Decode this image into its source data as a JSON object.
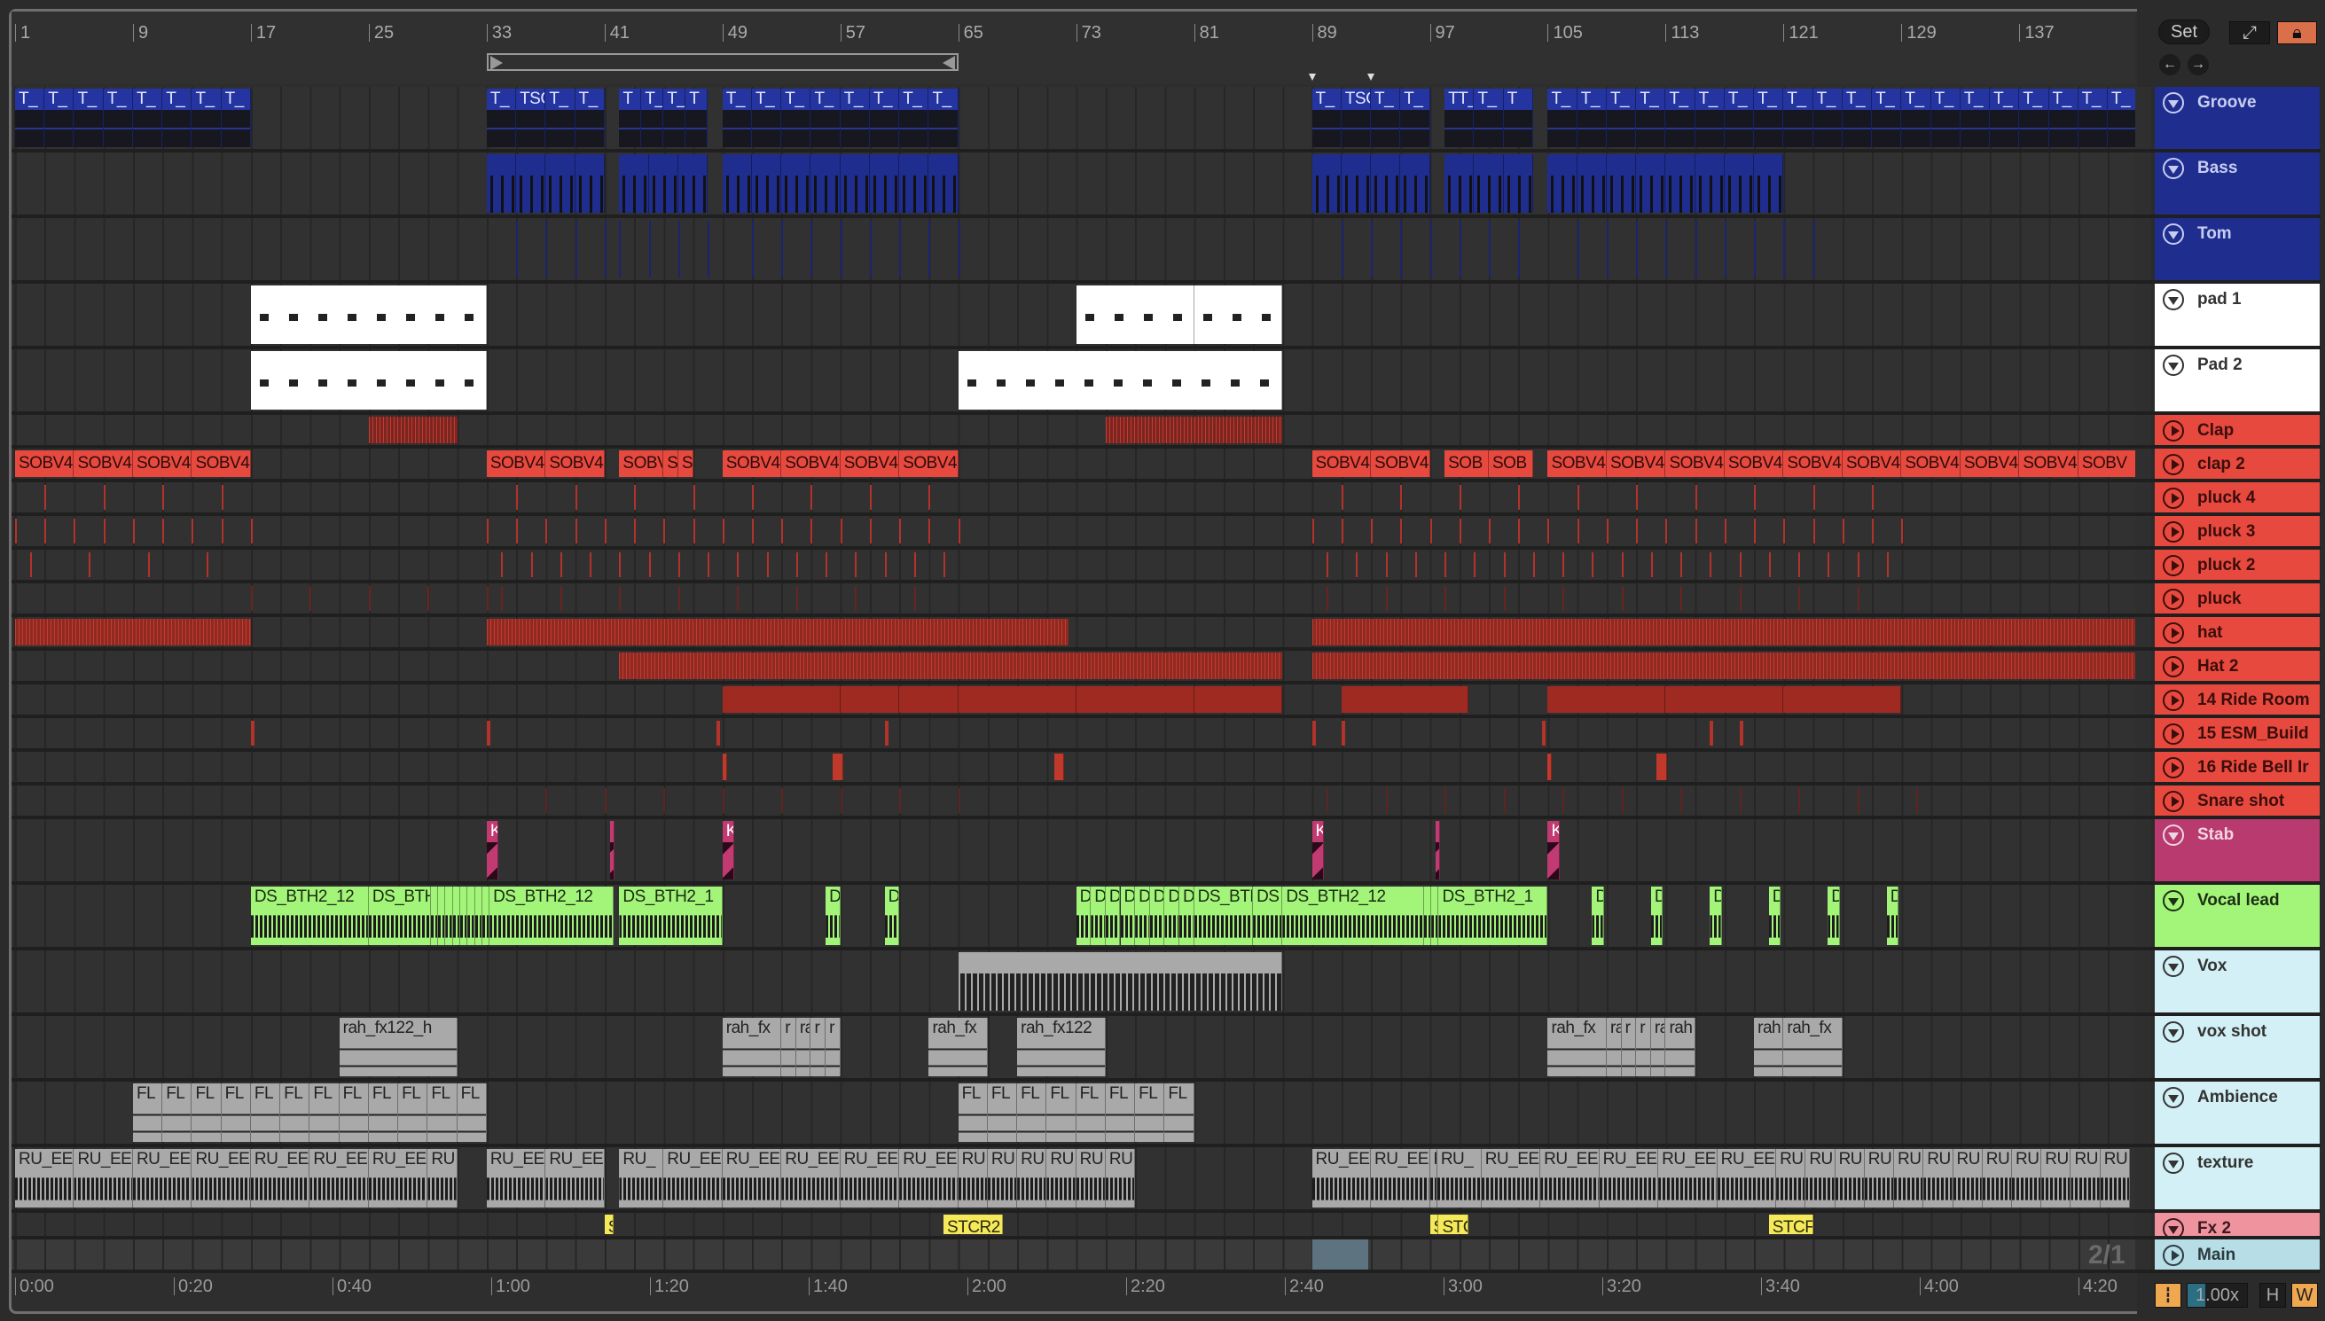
{
  "ruler": {
    "bars": [
      1,
      9,
      17,
      25,
      33,
      41,
      49,
      57,
      65,
      73,
      81,
      89,
      97,
      105,
      113,
      121,
      129,
      137
    ],
    "loop": [
      33,
      65
    ],
    "markers": [
      89,
      93
    ]
  },
  "time_ruler": {
    "labels": [
      "0:00",
      "0:20",
      "0:40",
      "1:00",
      "1:20",
      "1:40",
      "2:00",
      "2:20",
      "2:40",
      "3:00",
      "3:20",
      "3:40",
      "4:00",
      "4:20"
    ]
  },
  "controls": {
    "set_label": "Set",
    "arrangement_scale": "2/1",
    "tempo_factor": "1.00x",
    "h_label": "H",
    "w_label": "W",
    "tempo_fill_fraction": 0.3
  },
  "colors": {
    "accent_orange": "#f0a850",
    "lock_orange": "#d9704a",
    "blue": "#1f2d8f",
    "red": "#e8493f",
    "pink": "#c13b72",
    "green": "#a3f57a",
    "cyan": "#d2f0f5",
    "fx": "#ef949f",
    "main": "#b7dde6"
  },
  "selection": [
    89,
    92.8
  ],
  "tracks": [
    {
      "name": "Groove",
      "fold": "down",
      "hdr": "#1f2d8f",
      "hdrText": "#c8cdf0",
      "h": 70,
      "clipColor": "#2434a0",
      "clipText": "#e4e8ff",
      "body": "dark",
      "clips": [
        [
          "T_",
          1,
          2,
          8
        ],
        [
          "T_",
          33,
          2,
          1
        ],
        [
          "TSC",
          35,
          2,
          1
        ],
        [
          "T_",
          37,
          2,
          2
        ],
        [
          "T",
          42,
          1.5,
          1
        ],
        [
          "T_",
          43.5,
          1.5,
          2
        ],
        [
          "T",
          46.5,
          1.5,
          1
        ],
        [
          "T_",
          49,
          2,
          8
        ],
        [
          "T_",
          89,
          2,
          1
        ],
        [
          "TSC",
          91,
          2,
          1
        ],
        [
          "T_",
          93,
          2,
          2
        ],
        [
          "TT_",
          98,
          2,
          1
        ],
        [
          "T_",
          100,
          2,
          1
        ],
        [
          "T",
          102,
          2,
          1
        ],
        [
          "T_",
          105,
          2,
          20
        ]
      ]
    },
    {
      "name": "Bass",
      "fold": "down",
      "hdr": "#1f2d8f",
      "hdrText": "#c8cdf0",
      "h": 70,
      "clipColor": "#1f2d8f",
      "clipText": "#e4e8ff",
      "body": "midi",
      "clips": [
        [
          "",
          33,
          2,
          4
        ],
        [
          "",
          42,
          2,
          3
        ],
        [
          "",
          49,
          2,
          8
        ],
        [
          "",
          89,
          2,
          4
        ],
        [
          "",
          98,
          2,
          3
        ],
        [
          "",
          105,
          2,
          8
        ]
      ]
    },
    {
      "name": "Tom",
      "fold": "down",
      "hdr": "#1f2d8f",
      "hdrText": "#c8cdf0",
      "h": 70,
      "tickColor": "#1c2470",
      "ticks": [
        [
          35,
          41,
          2
        ],
        [
          42,
          48,
          2
        ],
        [
          51,
          65,
          2
        ],
        [
          91,
          97,
          2
        ],
        [
          99,
          104,
          2
        ],
        [
          107,
          123,
          2
        ]
      ]
    },
    {
      "name": "pad 1",
      "fold": "down",
      "hdr": "#ffffff",
      "hdrText": "#333333",
      "h": 70,
      "clipColor": "#ffffff",
      "clipText": "#222",
      "body": "midiw",
      "clips": [
        [
          "",
          17,
          16,
          1
        ],
        [
          "",
          73,
          8,
          1
        ],
        [
          "",
          81,
          6,
          1
        ]
      ]
    },
    {
      "name": "Pad 2",
      "fold": "down",
      "hdr": "#ffffff",
      "hdrText": "#333333",
      "h": 70,
      "clipColor": "#ffffff",
      "clipText": "#222",
      "body": "midiw",
      "clips": [
        [
          "",
          17,
          16,
          1
        ],
        [
          "",
          65,
          22,
          1
        ]
      ]
    },
    {
      "name": "Clap",
      "fold": "right",
      "hdr": "#e8493f",
      "hdrText": "#3a0e0b",
      "h": 34,
      "stripes": [
        [
          25,
          31
        ],
        [
          75,
          87
        ]
      ],
      "stripeColor": "#7a2620"
    },
    {
      "name": "clap 2",
      "fold": "right",
      "hdr": "#e8493f",
      "hdrText": "#3a0e0b",
      "h": 34,
      "small": true,
      "clipColor": "#e8493f",
      "clipText": "#2a0d0b",
      "clips": [
        [
          "SOBV4",
          1,
          4,
          4
        ],
        [
          "SOBV4",
          33,
          4,
          2
        ],
        [
          "SOBV4",
          42,
          3,
          1
        ],
        [
          "S",
          45,
          1,
          1
        ],
        [
          "S",
          46,
          1,
          1
        ],
        [
          "SOBV4",
          49,
          4,
          4
        ],
        [
          "SOBV4",
          89,
          4,
          2
        ],
        [
          "SOB",
          98,
          3,
          1
        ],
        [
          "SOB",
          101,
          3,
          1
        ],
        [
          "SOBV4",
          105,
          4,
          9
        ],
        [
          "SOBV",
          141,
          4,
          1
        ]
      ]
    },
    {
      "name": "pluck 4",
      "fold": "right",
      "hdr": "#e8493f",
      "hdrText": "#3a0e0b",
      "h": 34,
      "ticks": [
        [
          3,
          17,
          4
        ],
        [
          35,
          41,
          4
        ],
        [
          43,
          49,
          4
        ],
        [
          51,
          65,
          4
        ],
        [
          91,
          97,
          4
        ],
        [
          99,
          105,
          4
        ],
        [
          107,
          129,
          4
        ]
      ]
    },
    {
      "name": "pluck 3",
      "fold": "right",
      "hdr": "#e8493f",
      "hdrText": "#3a0e0b",
      "h": 34,
      "ticks": [
        [
          1,
          17,
          2
        ],
        [
          33,
          65,
          2
        ],
        [
          89,
          130,
          2
        ]
      ]
    },
    {
      "name": "pluck 2",
      "fold": "right",
      "hdr": "#e8493f",
      "hdrText": "#3a0e0b",
      "h": 34,
      "ticks": [
        [
          2,
          17,
          4
        ],
        [
          34,
          65,
          2
        ],
        [
          90,
          129,
          2
        ]
      ]
    },
    {
      "name": "pluck",
      "fold": "right",
      "hdr": "#e8493f",
      "hdrText": "#3a0e0b",
      "h": 34,
      "tickColor": "#6a2420",
      "ticks": [
        [
          17,
          33,
          4
        ],
        [
          34,
          65,
          4
        ],
        [
          90,
          129,
          4
        ]
      ]
    },
    {
      "name": "hat",
      "fold": "right",
      "hdr": "#e8493f",
      "hdrText": "#3a0e0b",
      "h": 34,
      "stripes": [
        [
          1,
          17
        ],
        [
          33,
          72.5
        ],
        [
          89,
          145
        ]
      ],
      "stripeColor": "#8e2a22"
    },
    {
      "name": "Hat 2",
      "fold": "right",
      "hdr": "#e8493f",
      "hdrText": "#3a0e0b",
      "h": 34,
      "stripes": [
        [
          42,
          87
        ],
        [
          89,
          145
        ]
      ],
      "stripeColor": "#8e2a22"
    },
    {
      "name": "14 Ride Room",
      "fold": "right",
      "hdr": "#e8493f",
      "hdrText": "#3a0e0b",
      "h": 34,
      "small": true,
      "clipColor": "#9e2a22",
      "clipText": "#2a0d0b",
      "clips": [
        [
          "",
          49,
          8,
          1
        ],
        [
          "",
          57,
          4,
          1
        ],
        [
          "",
          61,
          4,
          1
        ],
        [
          "",
          65,
          8,
          1
        ],
        [
          "",
          73,
          8,
          1
        ],
        [
          "",
          81,
          6,
          1
        ],
        [
          "",
          91,
          8.6,
          1
        ],
        [
          "",
          105,
          8,
          1
        ],
        [
          "",
          113,
          8,
          1
        ],
        [
          "",
          121,
          8,
          1
        ]
      ]
    },
    {
      "name": "15 ESM_Build",
      "fold": "right",
      "hdr": "#e8493f",
      "hdrText": "#3a0e0b",
      "h": 34,
      "ticks": [
        [
          17,
          17,
          1
        ],
        [
          33,
          33,
          1
        ],
        [
          48.6,
          48.6,
          1
        ],
        [
          60,
          60,
          1
        ],
        [
          89,
          89,
          1
        ],
        [
          91,
          91,
          1
        ],
        [
          104.6,
          104.6,
          1
        ],
        [
          116,
          116,
          1
        ],
        [
          118,
          118,
          1
        ]
      ],
      "tickWidth": 4
    },
    {
      "name": "16 Ride Bell Ir",
      "fold": "right",
      "hdr": "#e8493f",
      "hdrText": "#3a0e0b",
      "h": 34,
      "small": true,
      "clipColor": "#c0392b",
      "clipText": "#2a0d0b",
      "clips": [
        [
          "",
          49,
          0.3,
          1
        ],
        [
          "",
          56.5,
          0.7,
          1
        ],
        [
          "",
          71.5,
          0.7,
          1
        ],
        [
          "",
          105,
          0.3,
          1
        ],
        [
          "",
          112.4,
          0.7,
          1
        ]
      ]
    },
    {
      "name": "Snare shot",
      "fold": "right",
      "hdr": "#e8493f",
      "hdrText": "#3a0e0b",
      "h": 34,
      "tickColor": "#5e2420",
      "ticks": [
        [
          37,
          65,
          4
        ],
        [
          90,
          130,
          4
        ]
      ]
    },
    {
      "name": "Stab",
      "fold": "down",
      "hdr": "#b83a6e",
      "hdrText": "#f0d6e2",
      "h": 70,
      "clipColor": "#c13b72",
      "clipText": "#ffffff",
      "body": "stab",
      "clips": [
        [
          "K",
          33,
          0.8,
          1
        ],
        [
          "",
          41.4,
          0.3,
          1
        ],
        [
          "K",
          49,
          0.8,
          1
        ],
        [
          "K",
          89,
          0.8,
          1
        ],
        [
          "",
          97.4,
          0.3,
          1
        ],
        [
          "K",
          105,
          0.8,
          1
        ]
      ]
    },
    {
      "name": "Vocal lead",
      "fold": "down",
      "hdr": "#a3f57a",
      "hdrText": "#1d2e14",
      "h": 70,
      "clipColor": "#a3f57a",
      "clipText": "#1b2a12",
      "body": "wave",
      "clips": [
        [
          "DS_BTH2_12",
          17,
          8,
          1
        ],
        [
          "DS_BTH",
          25,
          4.2,
          1
        ],
        [
          "",
          29.2,
          0.5,
          8
        ],
        [
          "D",
          33,
          0.2,
          1
        ],
        [
          "DS_BTH2_12",
          33.2,
          8.4,
          1
        ],
        [
          "DS_BTH2_1",
          42,
          7,
          1
        ],
        [
          "D",
          56,
          1,
          1
        ],
        [
          "D",
          60,
          1,
          1
        ],
        [
          "D",
          73,
          1,
          8
        ],
        [
          "DS_BTH2",
          81,
          4,
          1
        ],
        [
          "DS",
          85,
          2,
          1
        ],
        [
          "DS_BTH2_12",
          87,
          9.6,
          1
        ],
        [
          "",
          96.6,
          0.5,
          2
        ],
        [
          "DS_BTH2_1",
          97.6,
          7.4,
          1
        ],
        [
          "D",
          108,
          0.8,
          1
        ],
        [
          "D",
          112,
          0.8,
          1
        ],
        [
          "D",
          116,
          0.8,
          1
        ],
        [
          "D",
          120,
          0.8,
          1
        ],
        [
          "D",
          124,
          0.8,
          1
        ],
        [
          "D",
          128,
          0.8,
          1
        ]
      ]
    },
    {
      "name": "Vox",
      "fold": "down",
      "hdr": "#d2f0f5",
      "hdrText": "#333333",
      "h": 70,
      "clipColor": "#a9a9a9",
      "clipText": "#222",
      "body": "slices",
      "clips": [
        [
          "",
          65,
          22,
          1
        ]
      ]
    },
    {
      "name": "vox shot",
      "fold": "down",
      "hdr": "#d2f0f5",
      "hdrText": "#333333",
      "h": 70,
      "clipColor": "#a9a9a9",
      "clipText": "#222",
      "body": "flat",
      "clips": [
        [
          "rah_fx122_h",
          23,
          8,
          1
        ],
        [
          "rah_fx",
          49,
          4,
          1
        ],
        [
          "r",
          53,
          1,
          1
        ],
        [
          "ra",
          54,
          1,
          1
        ],
        [
          "r",
          55,
          1,
          1
        ],
        [
          "r",
          56,
          1,
          1
        ],
        [
          "rah_fx",
          63,
          4,
          1
        ],
        [
          "rah_fx122",
          69,
          6,
          1
        ],
        [
          "rah_fx",
          105,
          4,
          1
        ],
        [
          "ra",
          109,
          1,
          1
        ],
        [
          "r",
          110,
          1,
          1
        ],
        [
          "r",
          111,
          1,
          1
        ],
        [
          "ra",
          112,
          1,
          1
        ],
        [
          "rah",
          113,
          2,
          1
        ],
        [
          "rah",
          119,
          2,
          1
        ],
        [
          "rah_fx",
          121,
          4,
          1
        ]
      ]
    },
    {
      "name": "Ambience",
      "fold": "down",
      "hdr": "#d2f0f5",
      "hdrText": "#333333",
      "h": 70,
      "clipColor": "#a9a9a9",
      "clipText": "#222",
      "body": "flat",
      "clips": [
        [
          "FL",
          9,
          2,
          12
        ],
        [
          "FL",
          65,
          2,
          8
        ]
      ]
    },
    {
      "name": "texture",
      "fold": "down",
      "hdr": "#d2f0f5",
      "hdrText": "#333333",
      "h": 70,
      "clipColor": "#a9a9a9",
      "clipText": "#222",
      "body": "wave",
      "clips": [
        [
          "RU_EE",
          1,
          4,
          7
        ],
        [
          "RU",
          29,
          2,
          1
        ],
        [
          "RU_EE",
          33,
          4,
          2
        ],
        [
          "RU_",
          42,
          3,
          1
        ],
        [
          "RU_EE",
          45,
          4,
          5
        ],
        [
          "RU",
          65,
          2,
          6
        ],
        [
          "RU_EE",
          89,
          4,
          2
        ],
        [
          "R",
          97,
          0.5,
          1
        ],
        [
          "RU_",
          97.5,
          3,
          1
        ],
        [
          "RU_EE",
          100.5,
          4,
          5
        ],
        [
          "RU",
          120.5,
          2,
          12
        ]
      ]
    },
    {
      "name": "Fx 2",
      "fold": "down",
      "hdr": "#ef949f",
      "hdrText": "#3a1a1e",
      "h": 26,
      "small": true,
      "clipColor": "#f5e95a",
      "clipText": "#2a2a10",
      "clips": [
        [
          "S",
          41,
          0.6,
          1
        ],
        [
          "STCR2",
          64,
          4,
          1
        ],
        [
          "S",
          97,
          0.6,
          1
        ],
        [
          "STC",
          97.6,
          2,
          1
        ],
        [
          "STCF",
          120,
          3,
          1
        ]
      ]
    },
    {
      "name": "Main",
      "fold": "right",
      "hdr": "#b7dde6",
      "hdrText": "#2b3b40",
      "h": 34,
      "main": true
    }
  ]
}
